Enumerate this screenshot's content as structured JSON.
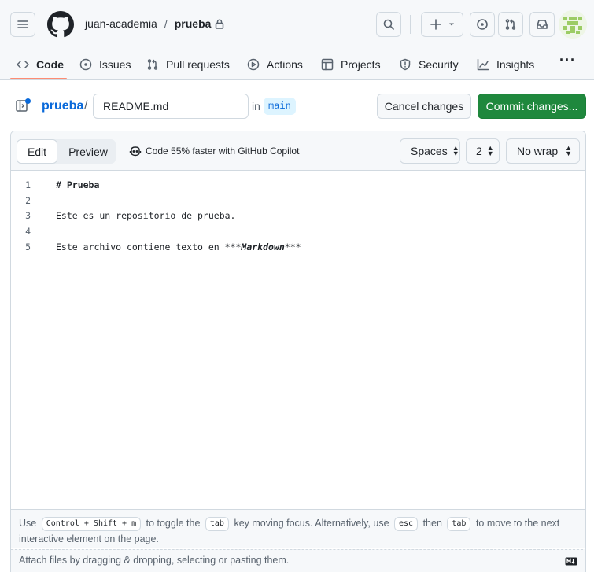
{
  "header": {
    "owner": "juan-academia",
    "separator": "/",
    "repo": "prueba"
  },
  "nav": {
    "tabs": [
      {
        "label": "Code",
        "icon": "code-icon",
        "active": true
      },
      {
        "label": "Issues",
        "icon": "issue-icon"
      },
      {
        "label": "Pull requests",
        "icon": "pull-request-icon"
      },
      {
        "label": "Actions",
        "icon": "play-icon"
      },
      {
        "label": "Projects",
        "icon": "table-icon"
      },
      {
        "label": "Security",
        "icon": "shield-icon"
      },
      {
        "label": "Insights",
        "icon": "graph-icon"
      }
    ],
    "more": "···"
  },
  "filebar": {
    "repo_link": "prueba",
    "slash": "/",
    "filename": "README.md",
    "in_label": "in",
    "branch": "main",
    "cancel_label": "Cancel changes",
    "commit_label": "Commit changes..."
  },
  "editor": {
    "edit_tab": "Edit",
    "preview_tab": "Preview",
    "copilot_text": "Code 55% faster with GitHub Copilot",
    "indent_mode": "Spaces",
    "indent_size": "2",
    "wrap_mode": "No wrap",
    "lines": [
      {
        "n": "1",
        "text": "# Prueba"
      },
      {
        "n": "2",
        "text": ""
      },
      {
        "n": "3",
        "text": "Este es un repositorio de prueba."
      },
      {
        "n": "4",
        "text": ""
      },
      {
        "n": "5",
        "text_pre": "Este archivo contiene texto en ***",
        "text_em": "Markdown",
        "text_post": "***"
      }
    ]
  },
  "hint": {
    "use": "Use",
    "key_combo": "Control + Shift + m",
    "to_toggle": "to toggle the",
    "tab_key": "tab",
    "key_moving": "key moving focus. Alternatively, use",
    "esc_key": "esc",
    "then": "then",
    "tab_key2": "tab",
    "to_move": "to move to the next interactive element on the page."
  },
  "attach": {
    "text": "Attach files by dragging & dropping, selecting or pasting them."
  },
  "colors": {
    "accent_link": "#0969da",
    "commit_green": "#1f883d",
    "active_tab_underline": "#fd8c73",
    "branch_bg": "#ddf4ff"
  }
}
